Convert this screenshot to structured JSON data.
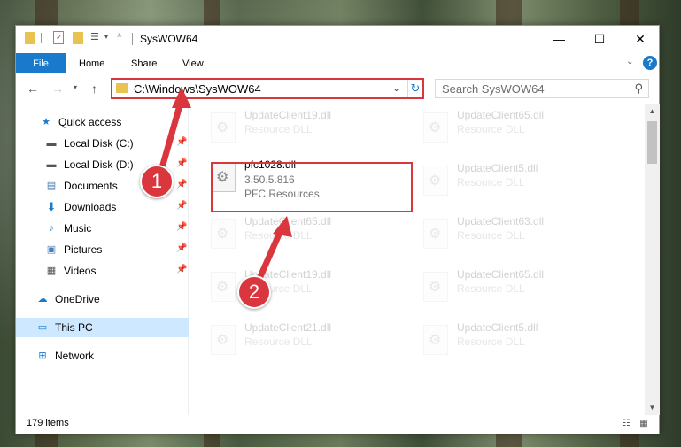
{
  "window": {
    "title": "SysWOW64",
    "controls": {
      "minimize": "—",
      "maximize": "☐",
      "close": "✕"
    }
  },
  "ribbon": {
    "tabs": [
      {
        "label": "File"
      },
      {
        "label": "Home"
      },
      {
        "label": "Share"
      },
      {
        "label": "View"
      }
    ],
    "help": "?"
  },
  "nav": {
    "address": "C:\\Windows\\SysWOW64",
    "search_placeholder": "Search SysWOW64"
  },
  "sidebar": {
    "items": [
      {
        "label": "Quick access",
        "icon": "star-icon"
      },
      {
        "label": "Local Disk (C:)",
        "icon": "drive-icon",
        "pinned": true
      },
      {
        "label": "Local Disk (D:)",
        "icon": "drive-icon",
        "pinned": true
      },
      {
        "label": "Documents",
        "icon": "documents-icon",
        "pinned": true
      },
      {
        "label": "Downloads",
        "icon": "download-icon",
        "pinned": true
      },
      {
        "label": "Music",
        "icon": "music-icon",
        "pinned": true
      },
      {
        "label": "Pictures",
        "icon": "pictures-icon",
        "pinned": true
      },
      {
        "label": "Videos",
        "icon": "videos-icon",
        "pinned": true
      },
      {
        "label": "OneDrive",
        "icon": "cloud-icon"
      },
      {
        "label": "This PC",
        "icon": "computer-icon",
        "selected": true
      },
      {
        "label": "Network",
        "icon": "network-icon"
      }
    ]
  },
  "files": [
    {
      "name": "UpdateClient19.dll",
      "desc": "Resource DLL"
    },
    {
      "name": "UpdateClient65.dll",
      "desc": "Resource DLL"
    },
    {
      "name": "pfc1028.dll",
      "version": "3.50.5.816",
      "desc": "PFC Resources"
    },
    {
      "name": "UpdateClient5.dll",
      "desc": "Resource DLL"
    },
    {
      "name": "UpdateClient65.dll",
      "desc": "Resource DLL"
    },
    {
      "name": "UpdateClient63.dll",
      "desc": "Resource DLL"
    },
    {
      "name": "UpdateClient19.dll",
      "desc": "Resource DLL"
    },
    {
      "name": "UpdateClient65.dll",
      "desc": "Resource DLL"
    },
    {
      "name": "UpdateClient21.dll",
      "desc": "Resource DLL"
    },
    {
      "name": "UpdateClient5.dll",
      "desc": "Resource DLL"
    }
  ],
  "status": {
    "item_count": "179 items"
  },
  "annotations": {
    "step1": "1",
    "step2": "2"
  },
  "colors": {
    "accent": "#1979ca",
    "highlight": "#d9363e",
    "selected": "#cde8ff"
  }
}
